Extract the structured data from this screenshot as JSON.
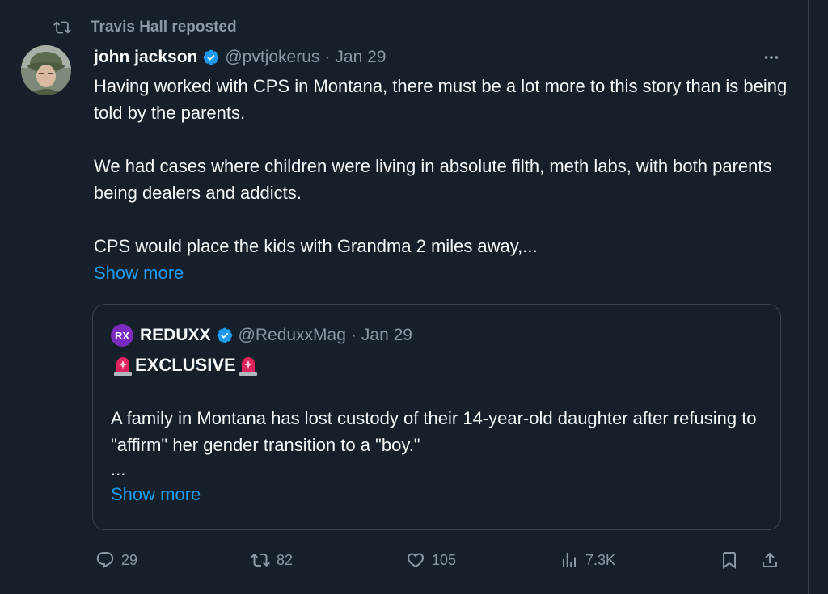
{
  "repost": {
    "label": "Travis Hall reposted",
    "icon": "repost-icon"
  },
  "tweet": {
    "author_name": "john jackson",
    "handle": "@pvtjokerus",
    "separator": "·",
    "date": "Jan 29",
    "paragraphs": [
      "Having worked with CPS in Montana, there must be a lot more to this story than is being told by the parents.",
      "We had cases where children were living in absolute filth, meth labs, with both parents being dealers and addicts.",
      "CPS would place the kids with Grandma 2 miles away,..."
    ],
    "show_more": "Show more",
    "more_icon": "more-horizontal-icon"
  },
  "quote": {
    "logo_text": "RX",
    "author_name": "REDUXX",
    "handle": "@ReduxxMag",
    "separator": "·",
    "date": "Jan 29",
    "exclusive": "EXCLUSIVE",
    "paragraph": "A family in Montana has lost custody of their 14-year-old daughter after refusing to \"affirm\" her gender transition to a \"boy.\"",
    "ellipsis": "...",
    "show_more": "Show more"
  },
  "actions": {
    "replies": "29",
    "reposts": "82",
    "likes": "105",
    "views": "7.3K"
  },
  "colors": {
    "background": "#15202b",
    "accent": "#1d9bf0",
    "muted": "#8b98a5",
    "border": "#38444d"
  }
}
